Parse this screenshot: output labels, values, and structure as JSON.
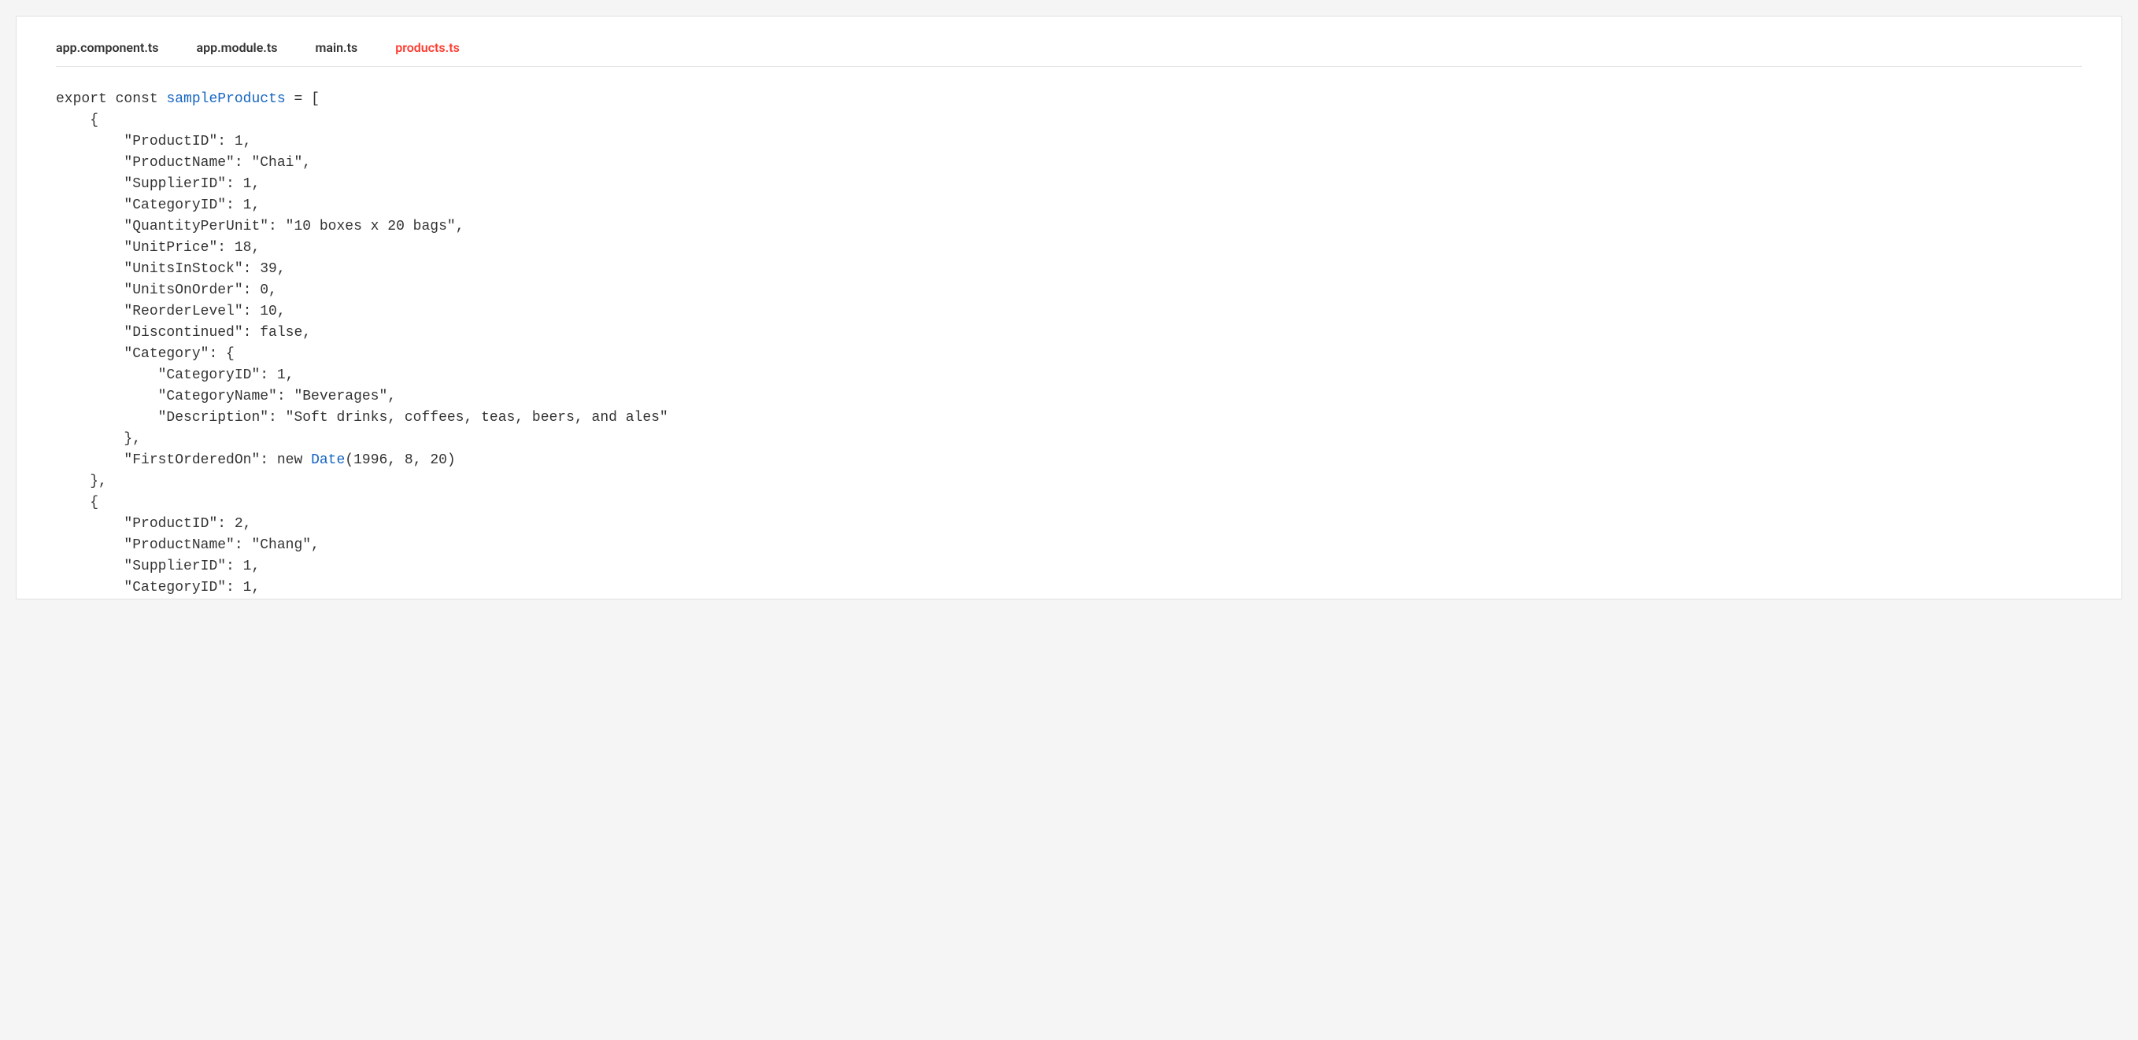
{
  "tabs": [
    {
      "label": "app.component.ts",
      "active": false
    },
    {
      "label": "app.module.ts",
      "active": false
    },
    {
      "label": "main.ts",
      "active": false
    },
    {
      "label": "products.ts",
      "active": true
    }
  ],
  "code": {
    "kw_export": "export",
    "kw_const": "const",
    "var_name": "sampleProducts",
    "eq_bracket": " = [",
    "obj_open": "{",
    "obj_close": "},",
    "cat_open": "\"Category\": {",
    "cat_close": "},",
    "p1_id": "\"ProductID\": 1,",
    "p1_name": "\"ProductName\": \"Chai\",",
    "p1_sup": "\"SupplierID\": 1,",
    "p1_cat": "\"CategoryID\": 1,",
    "p1_qpu": "\"QuantityPerUnit\": \"10 boxes x 20 bags\",",
    "p1_price": "\"UnitPrice\": 18,",
    "p1_stock": "\"UnitsInStock\": 39,",
    "p1_order": "\"UnitsOnOrder\": 0,",
    "p1_reorder": "\"ReorderLevel\": 10,",
    "p1_disc": "\"Discontinued\": false,",
    "p1_c_id": "\"CategoryID\": 1,",
    "p1_c_name": "\"CategoryName\": \"Beverages\",",
    "p1_c_desc": "\"Description\": \"Soft drinks, coffees, teas, beers, and ales\"",
    "p1_fo_key": "\"FirstOrderedOn\": ",
    "kw_new": "new",
    "type_date": "Date",
    "p1_fo_args": "(1996, 8, 20)",
    "p2_id": "\"ProductID\": 2,",
    "p2_name": "\"ProductName\": \"Chang\",",
    "p2_sup": "\"SupplierID\": 1,",
    "p2_cat": "\"CategoryID\": 1,"
  }
}
